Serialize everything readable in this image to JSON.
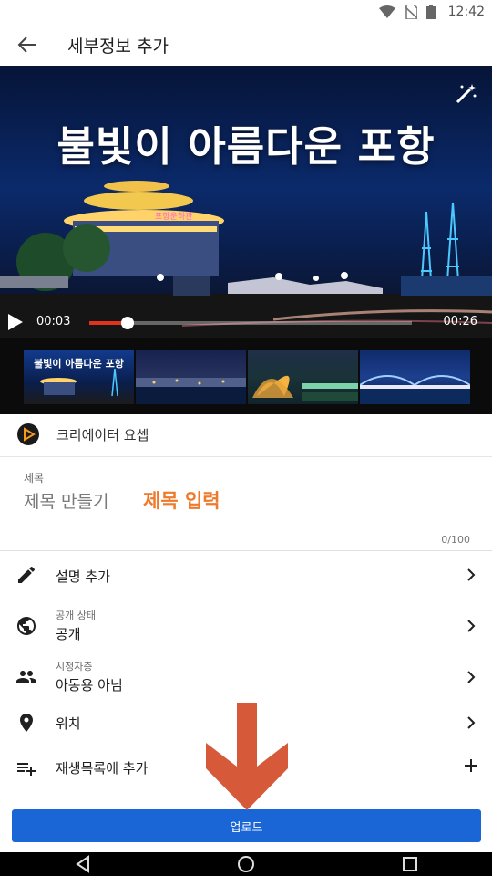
{
  "status_bar": {
    "time": "12:42",
    "icons": [
      "wifi-icon",
      "no-sim-icon",
      "battery-icon"
    ]
  },
  "app_bar": {
    "title": "세부정보 추가",
    "back_icon": "arrow-back-icon"
  },
  "video": {
    "overlay_title": "불빛이 아름다운 포항",
    "current_time": "00:03",
    "total_time": "00:26",
    "progress": 0.12,
    "magic_icon": "magic-wand-icon"
  },
  "thumbnails": [
    {
      "caption": "불빛이 아름다운 포항"
    },
    {
      "caption": ""
    },
    {
      "caption": ""
    },
    {
      "caption": ""
    }
  ],
  "channel": {
    "name": "크리에이터 요셉"
  },
  "title_field": {
    "label": "제목",
    "placeholder": "제목 만들기",
    "annotation": "제목 입력",
    "counter": "0/100"
  },
  "settings": {
    "description": {
      "label": "설명 추가"
    },
    "visibility": {
      "sublabel": "공개 상태",
      "value": "공개"
    },
    "audience": {
      "sublabel": "시청자층",
      "value": "아동용 아님"
    },
    "location": {
      "label": "위치"
    },
    "playlist": {
      "label": "재생목록에 추가"
    }
  },
  "upload_button": {
    "label": "업로드"
  },
  "colors": {
    "primary": "#1a66d6",
    "annotation": "#ee7a2b",
    "arrow": "#d65a3a",
    "progress": "#e0321c"
  }
}
